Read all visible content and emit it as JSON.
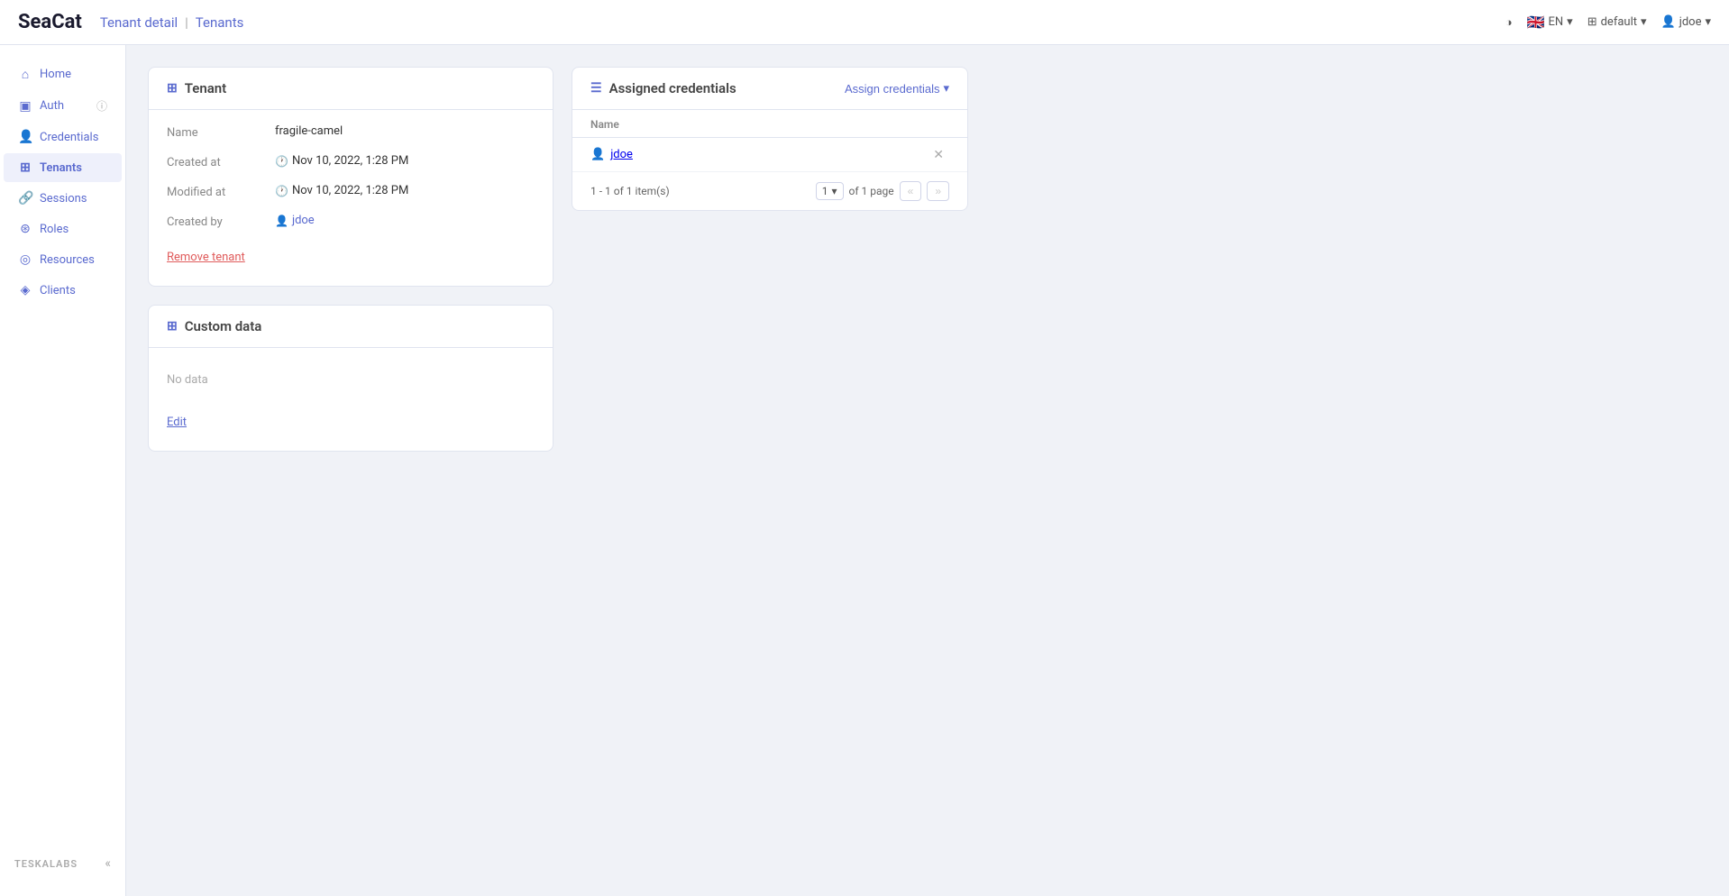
{
  "app": {
    "logo": "SeaCat",
    "page_title": "Tenant detail",
    "breadcrumb_separator": "|",
    "breadcrumb_parent": "Tenants"
  },
  "topnav": {
    "contrast_icon": "◑",
    "flag": "🇬🇧",
    "lang_label": "EN",
    "grid_icon": "⊞",
    "workspace_label": "default",
    "workspace_arrow": "▾",
    "user_icon": "👤",
    "user_label": "jdoe",
    "user_arrow": "▾"
  },
  "sidebar": {
    "items": [
      {
        "id": "home",
        "icon": "⌂",
        "label": "Home"
      },
      {
        "id": "auth",
        "icon": "▣",
        "label": "Auth",
        "has_info": true
      },
      {
        "id": "credentials",
        "icon": "👤",
        "label": "Credentials"
      },
      {
        "id": "tenants",
        "icon": "⊞",
        "label": "Tenants",
        "active": true
      },
      {
        "id": "sessions",
        "icon": "🔗",
        "label": "Sessions"
      },
      {
        "id": "roles",
        "icon": "⊛",
        "label": "Roles"
      },
      {
        "id": "resources",
        "icon": "◎",
        "label": "Resources"
      },
      {
        "id": "clients",
        "icon": "◈",
        "label": "Clients"
      }
    ],
    "bottom_logo": "TeskaLabs",
    "collapse_icon": "«"
  },
  "tenant_card": {
    "header_icon": "⊞",
    "title": "Tenant",
    "fields": [
      {
        "label": "Name",
        "value": "fragile-camel",
        "type": "text"
      },
      {
        "label": "Created at",
        "value": "Nov 10, 2022, 1:28 PM",
        "has_time_icon": true
      },
      {
        "label": "Modified at",
        "value": "Nov 10, 2022, 1:28 PM",
        "has_time_icon": true
      },
      {
        "label": "Created by",
        "value": "jdoe",
        "is_link": true,
        "has_user_icon": true
      }
    ],
    "remove_btn": "Remove tenant"
  },
  "custom_data_card": {
    "header_icon": "⊞",
    "title": "Custom data",
    "no_data_text": "No data",
    "edit_btn": "Edit"
  },
  "credentials_card": {
    "header_icon": "☰",
    "title": "Assigned credentials",
    "assign_btn": "Assign credentials",
    "assign_arrow": "▾",
    "table_header": "Name",
    "credentials": [
      {
        "id": "jdoe",
        "label": "jdoe",
        "is_link": true
      }
    ],
    "pagination": {
      "info": "1 - 1 of 1 item(s)",
      "page": "1",
      "of_page": "of 1 page",
      "prev_disabled": true,
      "next_disabled": true
    }
  }
}
